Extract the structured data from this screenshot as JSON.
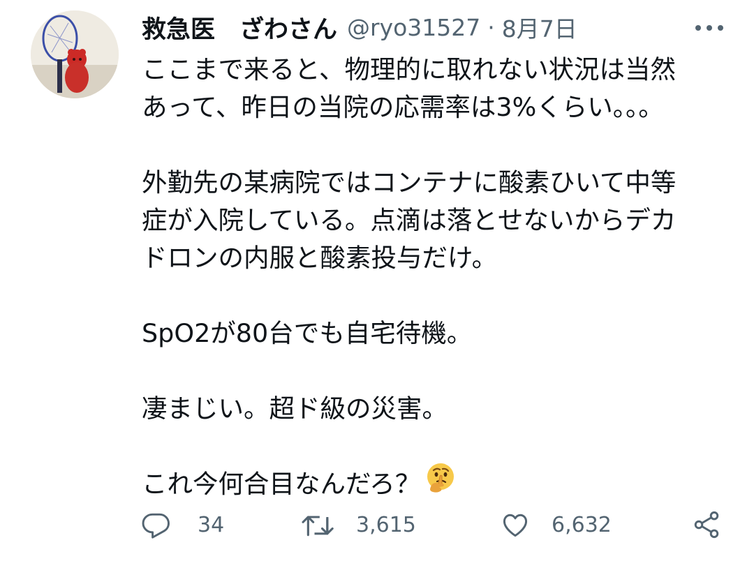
{
  "tweet": {
    "display_name": "救急医　ざわさん",
    "handle": "@ryo31527",
    "separator": "·",
    "date": "8月7日",
    "lines": [
      "ここまで来ると、物理的に取れない状況は当然",
      "あって、昨日の当院の応需率は3%くらい。。。",
      "",
      "外勤先の某病院ではコンテナに酸素ひいて中等",
      "症が入院している。点滴は落とせないからデカ",
      "ドロンの内服と酸素投与だけ。",
      "",
      "SpO2が80台でも自宅待機。",
      "",
      "凄まじい。超ド級の災害。",
      "",
      "これ今何合目なんだろ？"
    ],
    "emoji_icon": "thinking-face-icon"
  },
  "actions": {
    "reply_count": "34",
    "retweet_count": "3,615",
    "like_count": "6,632"
  },
  "icons": {
    "avatar": "avatar-image",
    "more": "more-options-icon",
    "reply": "reply-icon",
    "retweet": "retweet-icon",
    "like": "heart-icon",
    "share": "share-icon"
  },
  "colors": {
    "text": "#0f1419",
    "secondary": "#536471",
    "background": "#ffffff"
  }
}
